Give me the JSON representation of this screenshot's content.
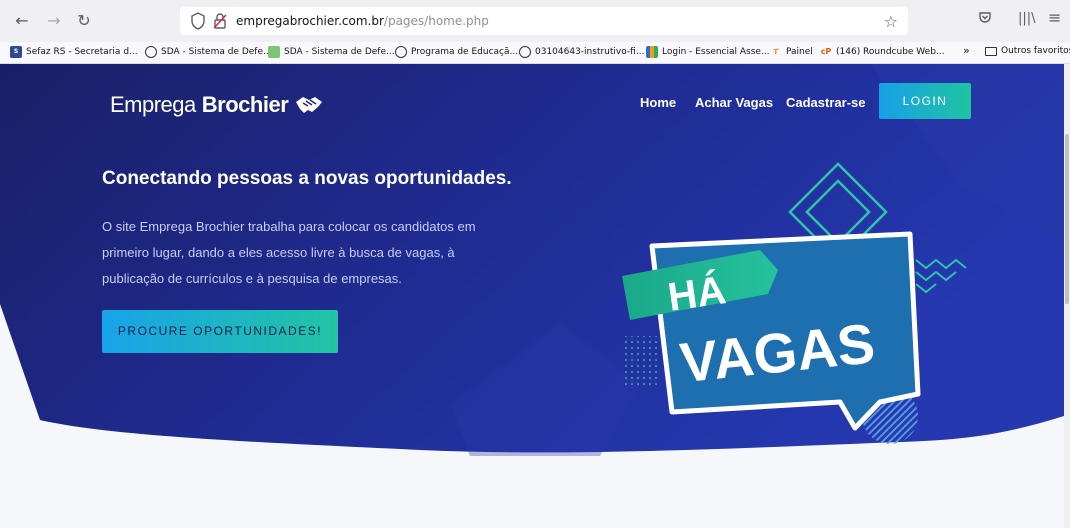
{
  "browser": {
    "url_domain": "empregabrochier.com.br",
    "url_path": "/pages/home.php",
    "bookmarks": [
      {
        "label": "Sefaz RS - Secretaria d...",
        "icon": "sefaz-icon"
      },
      {
        "label": "SDA - Sistema de Defe...",
        "icon": "globe-icon"
      },
      {
        "label": "SDA - Sistema de Defe...",
        "icon": "sda-icon"
      },
      {
        "label": "Programa de Educaçã...",
        "icon": "globe-icon"
      },
      {
        "label": "03104643-instrutivo-fi...",
        "icon": "globe-icon"
      },
      {
        "label": "Login - Essencial Asse...",
        "icon": "chart-icon"
      },
      {
        "label": "Painel",
        "icon": "painel-icon"
      },
      {
        "label": "(146) Roundcube Web...",
        "icon": "cpanel-icon"
      }
    ],
    "overflow_label": "»",
    "other_bookmarks": "Outros favoritos"
  },
  "header": {
    "logo_thin": "Emprega",
    "logo_bold": "Brochier",
    "nav": [
      "Home",
      "Achar Vagas",
      "Cadastrar-se"
    ],
    "login": "LOGIN"
  },
  "hero": {
    "headline": "Conectando pessoas a novas oportunidades.",
    "description": "O site Emprega Brochier trabalha para colocar os candidatos em primeiro lugar, dando a eles acesso livre à busca de vagas, à publicação de currículos e à pesquisa de empresas.",
    "cta": "PROCURE OPORTUNIDADES!",
    "illustration_word_1": "HÁ",
    "illustration_word_2": "VAGAS"
  },
  "colors": {
    "hero_dark": "#1a2067",
    "hero_mid": "#2235a8",
    "accent_teal": "#1fc4a0",
    "accent_blue": "#17a0e8",
    "badge_blue": "#1e6fb0",
    "badge_green": "#1aa889"
  }
}
